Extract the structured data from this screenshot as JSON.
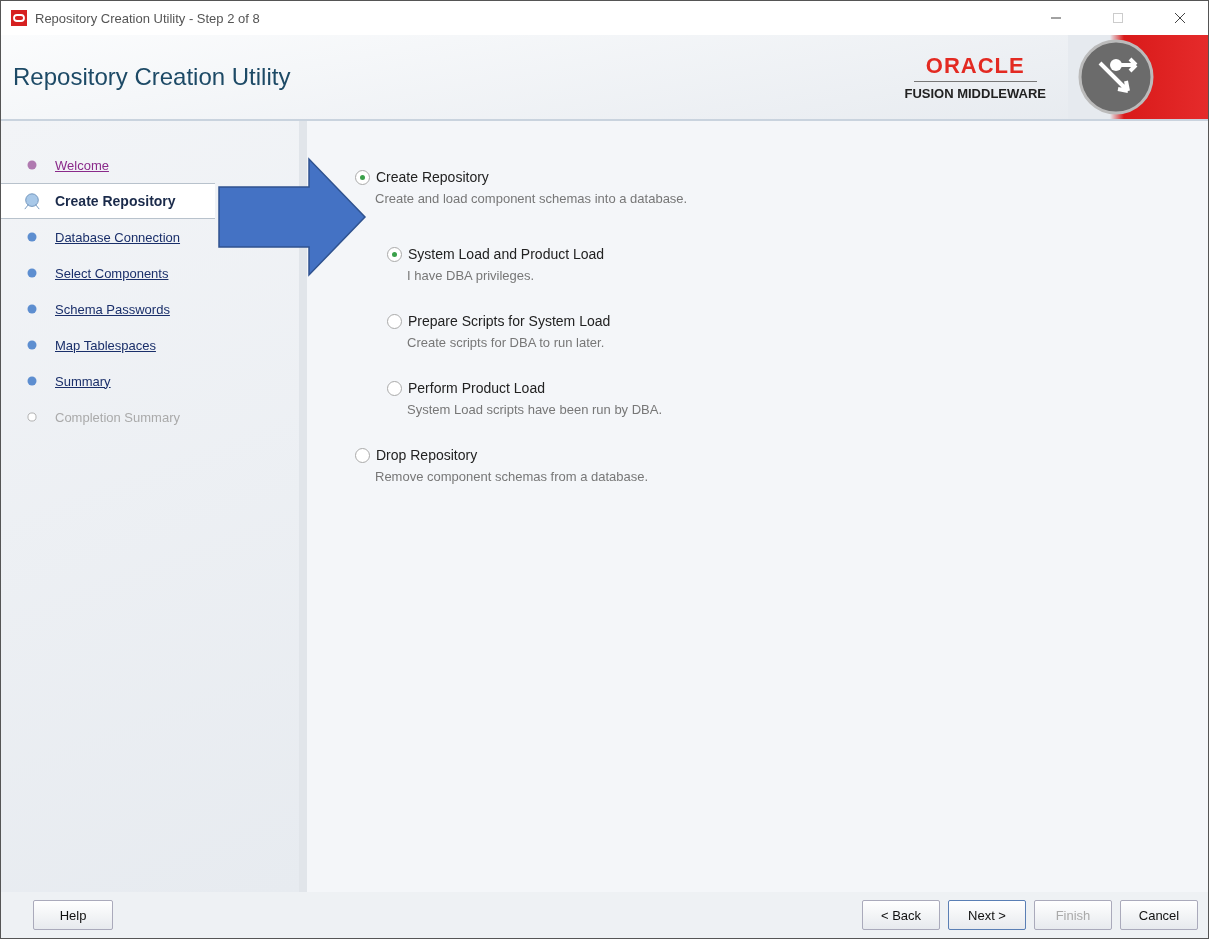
{
  "window": {
    "title": "Repository Creation Utility - Step 2 of 8"
  },
  "header": {
    "title": "Repository Creation Utility",
    "logo_brand": "ORACLE",
    "logo_product": "FUSION MIDDLEWARE"
  },
  "steps": [
    {
      "label": "Welcome",
      "kind": "visited",
      "selected": false
    },
    {
      "label": "Create Repository",
      "kind": "current",
      "selected": true
    },
    {
      "label": "Database Connection",
      "kind": "pending",
      "selected": false
    },
    {
      "label": "Select Components",
      "kind": "pending",
      "selected": false
    },
    {
      "label": "Schema Passwords",
      "kind": "pending",
      "selected": false
    },
    {
      "label": "Map Tablespaces",
      "kind": "pending",
      "selected": false
    },
    {
      "label": "Summary",
      "kind": "pending",
      "selected": false
    },
    {
      "label": "Completion Summary",
      "kind": "disabled",
      "selected": false
    }
  ],
  "options": [
    {
      "label": "Create Repository",
      "description": "Create and load component schemas into a database.",
      "selected": true,
      "children": [
        {
          "label": "System Load and Product Load",
          "description": "I have DBA privileges.",
          "selected": true
        },
        {
          "label": "Prepare Scripts for System Load",
          "description": "Create scripts for DBA to run later.",
          "selected": false
        },
        {
          "label": "Perform Product Load",
          "description": "System Load scripts have been run by DBA.",
          "selected": false
        }
      ]
    },
    {
      "label": "Drop Repository",
      "description": "Remove component schemas from a database.",
      "selected": false
    }
  ],
  "buttons": {
    "help": {
      "label": "Help"
    },
    "nav": [
      {
        "label": "< Back",
        "disabled": false,
        "default": false
      },
      {
        "label": "Next >",
        "disabled": false,
        "default": true
      },
      {
        "label": "Finish",
        "disabled": true,
        "default": false
      },
      {
        "label": "Cancel",
        "disabled": false,
        "default": false
      }
    ]
  }
}
